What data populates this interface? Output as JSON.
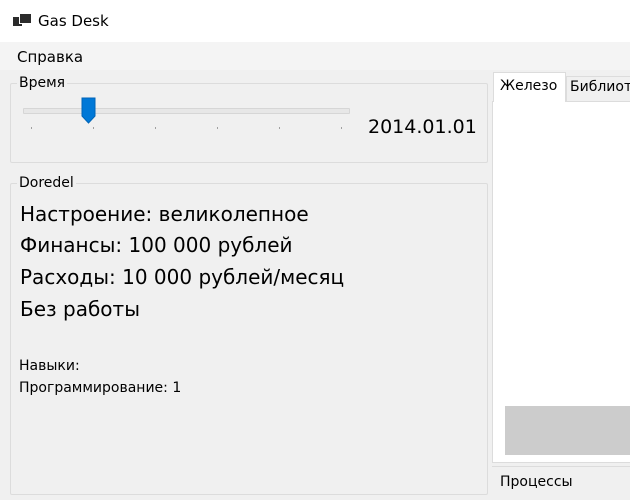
{
  "window": {
    "title": "Gas Desk",
    "icon": "windows-app-icon"
  },
  "menu": {
    "items": [
      {
        "label": "Справка"
      }
    ]
  },
  "time_group": {
    "title": "Время",
    "date": "2014.01.01",
    "slider_level": 0.2
  },
  "person": {
    "title": "Doredel",
    "lines": [
      "Настроение: великолепное",
      "Финансы: 100 000 рублей",
      "Расходы: 10 000 рублей/месяц",
      "Без работы"
    ],
    "skills_header": "Навыки:",
    "skills": [
      "Программирование: 1"
    ]
  },
  "tabs": [
    {
      "label": "Железо",
      "active": true
    },
    {
      "label": "Библиотеки",
      "active": false
    }
  ],
  "processes": {
    "label": "Процессы"
  },
  "colors": {
    "slider_thumb": "#0078d7",
    "panel_gray": "#cccccc",
    "border": "#dcdcdc"
  }
}
